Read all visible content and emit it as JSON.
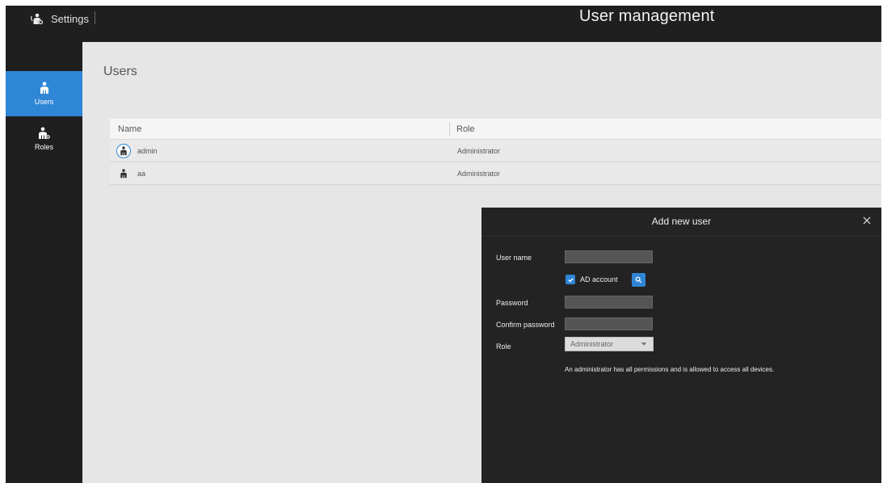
{
  "topbar": {
    "settings_label": "Settings",
    "title": "User management"
  },
  "sidebar": {
    "items": [
      {
        "label": "Users",
        "icon": "user-icon",
        "active": true
      },
      {
        "label": "Roles",
        "icon": "user-gear-icon",
        "active": false
      }
    ]
  },
  "main": {
    "section_title": "Users",
    "table": {
      "columns": [
        "Name",
        "Role"
      ],
      "rows": [
        {
          "name": "admin",
          "role": "Administrator"
        },
        {
          "name": "aa",
          "role": "Administrator"
        }
      ]
    }
  },
  "dialog": {
    "title": "Add new user",
    "fields": {
      "username_label": "User name",
      "username_value": "",
      "ad_account_label": "AD account",
      "ad_account_checked": true,
      "password_label": "Password",
      "password_value": "",
      "confirm_label": "Confirm password",
      "confirm_value": "",
      "role_label": "Role",
      "role_value": "Administrator"
    },
    "role_description": "An administrator has all permissions and is allowed to access all devices."
  },
  "colors": {
    "accent": "#2f86d6",
    "topbar_bg": "#1f1f1f",
    "content_bg": "#e6e6e6",
    "dialog_bg": "#232323"
  }
}
